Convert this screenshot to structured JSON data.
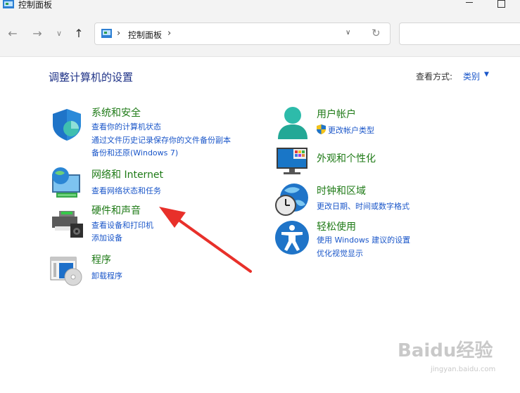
{
  "window": {
    "title": "控制面板"
  },
  "nav": {
    "back_icon": "arrow-left-icon",
    "forward_icon": "arrow-right-icon",
    "recent_icon": "chevron-down-icon",
    "up_icon": "arrow-up-icon",
    "address": {
      "separator": "›",
      "location": "控制面板",
      "trailing_separator": "›"
    },
    "search_placeholder": ""
  },
  "main": {
    "heading": "调整计算机的设置",
    "view_by_label": "查看方式:",
    "view_by_value": "类别"
  },
  "categories_left": [
    {
      "title": "系统和安全",
      "icon": "shield-icon",
      "links": [
        "查看你的计算机状态",
        "通过文件历史记录保存你的文件备份副本",
        "备份和还原(Windows 7)"
      ]
    },
    {
      "title": "网络和 Internet",
      "icon": "network-globe-icon",
      "links": [
        "查看网络状态和任务"
      ]
    },
    {
      "title": "硬件和声音",
      "icon": "printer-speaker-icon",
      "links": [
        "查看设备和打印机",
        "添加设备"
      ]
    },
    {
      "title": "程序",
      "icon": "programs-disc-icon",
      "links": [
        "卸载程序"
      ]
    }
  ],
  "categories_right": [
    {
      "title": "用户帐户",
      "icon": "user-icon",
      "links": [
        "更改帐户类型"
      ]
    },
    {
      "title": "外观和个性化",
      "icon": "monitor-icon",
      "links": []
    },
    {
      "title": "时钟和区域",
      "icon": "clock-globe-icon",
      "links": [
        "更改日期、时间或数字格式"
      ]
    },
    {
      "title": "轻松使用",
      "icon": "accessibility-icon",
      "links": [
        "使用 Windows 建议的设置",
        "优化视觉显示"
      ]
    }
  ],
  "colors": {
    "category_title": "#1e7a16",
    "link": "#1a56c9",
    "heading": "#1e3287",
    "annotation_arrow": "#e8302a"
  },
  "watermark": {
    "text": "Baidu经验",
    "sub": "jingyan.baidu.com"
  }
}
